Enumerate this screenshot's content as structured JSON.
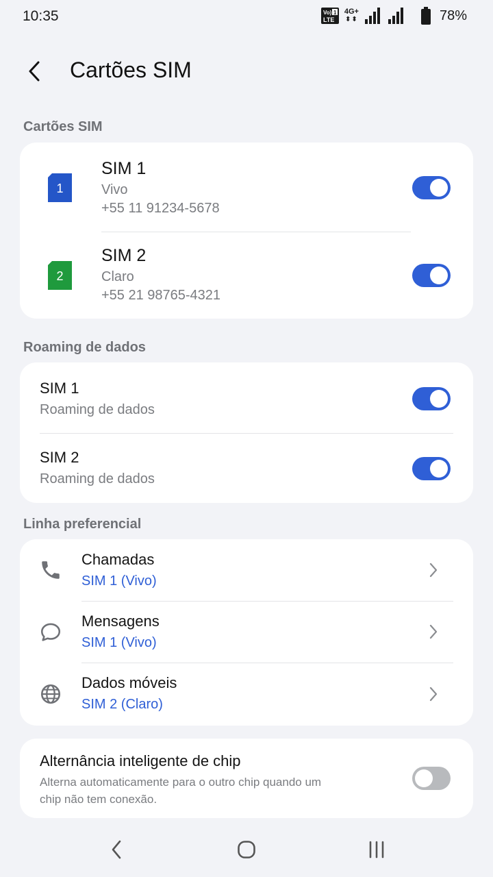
{
  "status_bar": {
    "time": "10:35",
    "volte_label": "Vo) 1\nLTE",
    "network_label": "4G+",
    "battery_percent": "78%",
    "icons": [
      "volte-icon",
      "network-4g-icon",
      "signal-icon",
      "signal-icon",
      "battery-icon"
    ]
  },
  "header": {
    "back_icon": "chevron-left-icon",
    "title": "Cartões SIM"
  },
  "sim_cards": {
    "section_title": "Cartões SIM",
    "items": [
      {
        "icon_number": "1",
        "icon_color": "#2456c8",
        "title": "SIM 1",
        "carrier": "Vivo",
        "number": "+55 11 91234-5678",
        "enabled": true
      },
      {
        "icon_number": "2",
        "icon_color": "#1f9a3d",
        "title": "SIM 2",
        "carrier": "Claro",
        "number": "+55 21 98765-4321",
        "enabled": true
      }
    ]
  },
  "roaming": {
    "section_title": "Roaming de dados",
    "items": [
      {
        "title": "SIM 1",
        "subtitle": "Roaming de dados",
        "enabled": true
      },
      {
        "title": "SIM 2",
        "subtitle": "Roaming de dados",
        "enabled": true
      }
    ]
  },
  "preferred_line": {
    "section_title": "Linha preferencial",
    "items": [
      {
        "icon": "phone-icon",
        "title": "Chamadas",
        "value": "SIM 1 (Vivo)"
      },
      {
        "icon": "message-icon",
        "title": "Mensagens",
        "value": "SIM 1 (Vivo)"
      },
      {
        "icon": "globe-icon",
        "title": "Dados móveis",
        "value": "SIM 2 (Claro)"
      }
    ]
  },
  "smart_switch": {
    "title": "Alternância inteligente de chip",
    "description": "Alterna automaticamente para o outro chip quando um chip não tem conexão.",
    "enabled": false
  },
  "colors": {
    "accent": "#2f5fd6",
    "background": "#f2f3f7",
    "card": "#ffffff",
    "secondary_text": "#7a7c80"
  },
  "nav_bar": {
    "icons": [
      "back-nav-icon",
      "home-nav-icon",
      "recents-nav-icon"
    ]
  }
}
